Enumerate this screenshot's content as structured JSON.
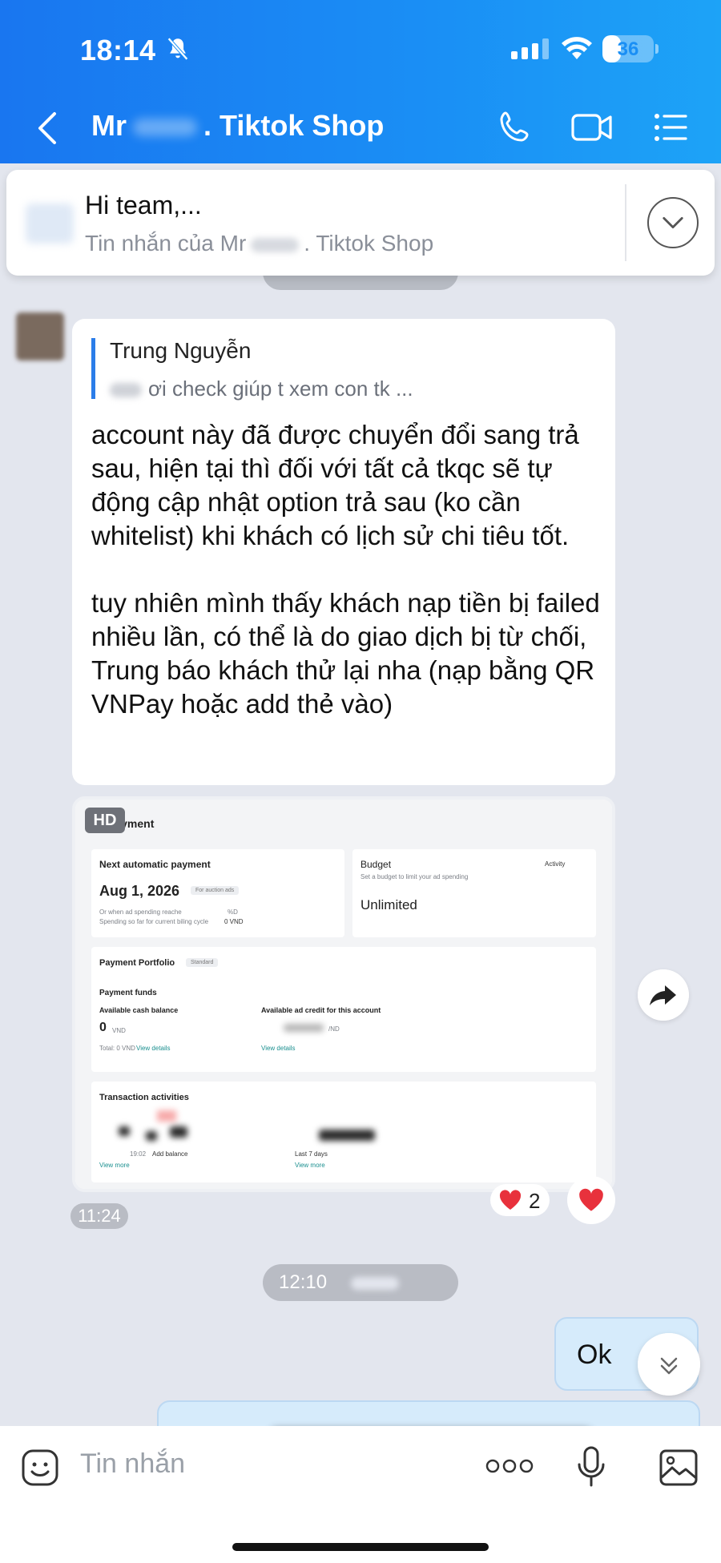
{
  "status": {
    "time": "18:14",
    "battery": "36",
    "battery_level": 0.36
  },
  "header": {
    "name_prefix": "Mr",
    "name_suffix": ". Tiktok Shop"
  },
  "pinned": {
    "title": "Hi team,...",
    "subtitle_prefix": "Tin nhắn của Mr",
    "subtitle_suffix": ". Tiktok Shop"
  },
  "messages": {
    "reply_name": "Trung Nguyễn",
    "reply_text": "ơi check giúp t xem con tk ...",
    "body": "account này đã được chuyển đổi sang trả sau, hiện tại thì đối với tất cả tkqc sẽ tự động cập nhật option trả sau (ko cần whitelist) khi khách có lịch sử chi tiêu tốt.\n\ntuy nhiên mình thấy khách nạp tiền bị failed nhiều lần, có thể là do giao dịch bị từ chối, Trung báo khách thử lại nha (nạp bằng QR VNPay hoặc add thẻ vào)",
    "image_badge": "HD",
    "reaction_count": "2",
    "time_1": "11:24",
    "date_chip": "12:10",
    "reply_out": "Ok"
  },
  "screenshot": {
    "page_title": "Payment",
    "next_payment_label": "Next automatic payment",
    "next_payment_date": "Aug 1, 2026",
    "auction_chip": "For auction ads",
    "reach_note": "Or when ad spending reache",
    "reach_tail": "%D",
    "spending_note": "Spending so far for current biling cycle",
    "spending_value": "0 VND",
    "budget_label": "Budget",
    "budget_note": "Set a budget to limit your ad spending",
    "budget_activity": "Activity",
    "budget_value": "Unlimited",
    "portfolio_label": "Payment Portfolio",
    "portfolio_chip": "Standard",
    "funds_label": "Payment funds",
    "cash_label": "Available cash balance",
    "cash_value": "0",
    "cash_unit": "VND",
    "total_label": "Total: 0 VND",
    "view_details": "View details",
    "credit_label": "Available ad credit for this account",
    "credit_unit": "/ND",
    "credit_view": "View details",
    "tx_label": "Transaction activities",
    "tx_time": "19:02",
    "tx_add": "Add balance",
    "tx_view_more": "View more",
    "tx_last7": "Last 7 days",
    "tx_view_more2": "View more"
  },
  "composer": {
    "placeholder": "Tin nhắn"
  }
}
